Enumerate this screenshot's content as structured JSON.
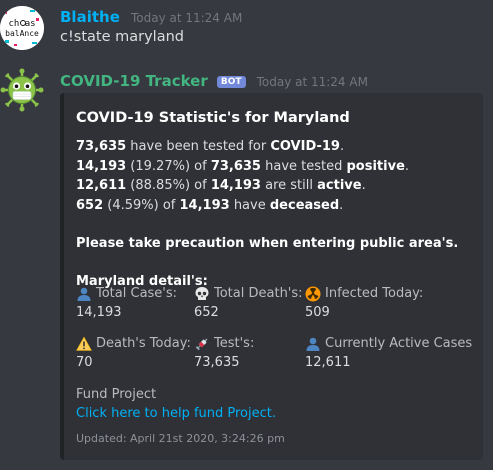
{
  "messages": [
    {
      "author": "Blaithe",
      "author_color": "#00b0f4",
      "timestamp": "Today at 11:24 AM",
      "avatar_text_top": "ch  as",
      "avatar_text_bottom": "balAnce",
      "content": "c!state maryland"
    }
  ],
  "bot_message": {
    "author": "COVID-19 Tracker",
    "author_color": "#43b581",
    "bot_tag": "BOT",
    "timestamp": "Today at 11:24 AM",
    "avatar_icon": "virus-mask-icon"
  },
  "embed": {
    "title": "COVID-19 Statistic's for Maryland",
    "description_lines": [
      [
        {
          "text": "73,635",
          "bold": true
        },
        {
          "text": " have been tested for ",
          "bold": false
        },
        {
          "text": "COVID-19",
          "bold": true
        },
        {
          "text": ".",
          "bold": false
        }
      ],
      [
        {
          "text": "14,193",
          "bold": true
        },
        {
          "text": " (19.27%) of ",
          "bold": false
        },
        {
          "text": "73,635",
          "bold": true
        },
        {
          "text": " have tested ",
          "bold": false
        },
        {
          "text": "positive",
          "bold": true
        },
        {
          "text": ".",
          "bold": false
        }
      ],
      [
        {
          "text": "12,611",
          "bold": true
        },
        {
          "text": " (88.85%) of ",
          "bold": false
        },
        {
          "text": "14,193",
          "bold": true
        },
        {
          "text": " are still ",
          "bold": false
        },
        {
          "text": "active",
          "bold": true
        },
        {
          "text": ".",
          "bold": false
        }
      ],
      [
        {
          "text": "652",
          "bold": true
        },
        {
          "text": " (4.59%) of ",
          "bold": false
        },
        {
          "text": "14,193",
          "bold": true
        },
        {
          "text": " have ",
          "bold": false
        },
        {
          "text": "deceased",
          "bold": true
        },
        {
          "text": ".",
          "bold": false
        }
      ]
    ],
    "precaution": "Please take precaution when entering public area's.",
    "detail_heading": "Maryland detail's:",
    "fields": [
      {
        "icon": "person-icon",
        "name": "Total Case's:",
        "value": "14,193"
      },
      {
        "icon": "skull-icon",
        "name": "Total Death's:",
        "value": "652"
      },
      {
        "icon": "radioactive-icon",
        "name": "Infected Today:",
        "value": "509"
      },
      {
        "icon": "warning-icon",
        "name": "Death's Today:",
        "value": "70"
      },
      {
        "icon": "syringe-icon",
        "name": "Test's:",
        "value": "73,635"
      },
      {
        "icon": "person-icon",
        "name": "Currently Active Cases",
        "value": "12,611"
      }
    ],
    "fund_label": "Fund Project",
    "fund_link": "Click here to help fund Project.",
    "footer": "Updated: April 21st 2020, 3:24:26 pm"
  },
  "colors": {
    "background": "#36393f",
    "embed_background": "#2f3136",
    "link": "#00b0f4",
    "bot_tag": "#7289da"
  }
}
